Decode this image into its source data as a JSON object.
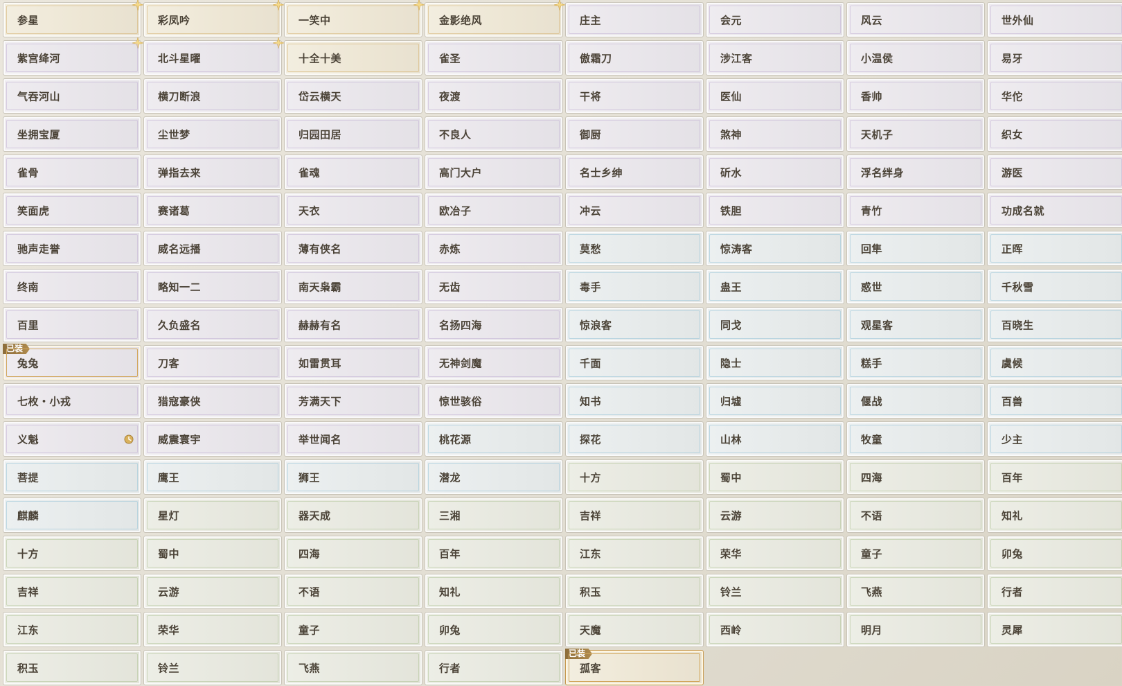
{
  "equipped_tag": "已装",
  "colors": {
    "gold": "#d5b474",
    "purple": "#c4b6d6",
    "blue": "#9cc7d8",
    "green": "#b4c69c",
    "label": "#4b4337",
    "equipped_tag_bg": "#9a7a44"
  },
  "titles": [
    {
      "label": "参星",
      "tier": "gold",
      "sparkle": true
    },
    {
      "label": "彩凤吟",
      "tier": "gold",
      "sparkle": true
    },
    {
      "label": "一笑中",
      "tier": "gold",
      "sparkle": true
    },
    {
      "label": "金影绝风",
      "tier": "gold",
      "sparkle": true
    },
    {
      "label": "庄主",
      "tier": "purple"
    },
    {
      "label": "会元",
      "tier": "purple"
    },
    {
      "label": "风云",
      "tier": "purple"
    },
    {
      "label": "世外仙",
      "tier": "purple"
    },
    {
      "label": "紫宫绛河",
      "tier": "purple",
      "sparkle": true
    },
    {
      "label": "北斗星曜",
      "tier": "purple",
      "sparkle": true
    },
    {
      "label": "十全十美",
      "tier": "gold"
    },
    {
      "label": "雀圣",
      "tier": "purple"
    },
    {
      "label": "傲霜刀",
      "tier": "purple"
    },
    {
      "label": "涉江客",
      "tier": "purple"
    },
    {
      "label": "小温侯",
      "tier": "purple"
    },
    {
      "label": "易牙",
      "tier": "purple"
    },
    {
      "label": "气吞河山",
      "tier": "purple"
    },
    {
      "label": "横刀断浪",
      "tier": "purple"
    },
    {
      "label": "岱云横天",
      "tier": "purple"
    },
    {
      "label": "夜渡",
      "tier": "purple"
    },
    {
      "label": "干将",
      "tier": "purple"
    },
    {
      "label": "医仙",
      "tier": "purple"
    },
    {
      "label": "香帅",
      "tier": "purple"
    },
    {
      "label": "华佗",
      "tier": "purple"
    },
    {
      "label": "坐拥宝厦",
      "tier": "purple"
    },
    {
      "label": "尘世梦",
      "tier": "purple"
    },
    {
      "label": "归园田居",
      "tier": "purple"
    },
    {
      "label": "不良人",
      "tier": "purple"
    },
    {
      "label": "御厨",
      "tier": "purple"
    },
    {
      "label": "煞神",
      "tier": "purple"
    },
    {
      "label": "天机子",
      "tier": "purple"
    },
    {
      "label": "织女",
      "tier": "purple"
    },
    {
      "label": "雀骨",
      "tier": "purple"
    },
    {
      "label": "弹指去来",
      "tier": "purple"
    },
    {
      "label": "雀魂",
      "tier": "purple"
    },
    {
      "label": "高门大户",
      "tier": "purple"
    },
    {
      "label": "名士乡绅",
      "tier": "purple"
    },
    {
      "label": "斫水",
      "tier": "purple"
    },
    {
      "label": "浮名绊身",
      "tier": "purple"
    },
    {
      "label": "游医",
      "tier": "purple"
    },
    {
      "label": "笑面虎",
      "tier": "purple"
    },
    {
      "label": "赛诸葛",
      "tier": "purple"
    },
    {
      "label": "天衣",
      "tier": "purple"
    },
    {
      "label": "欧冶子",
      "tier": "purple"
    },
    {
      "label": "冲云",
      "tier": "purple"
    },
    {
      "label": "铁胆",
      "tier": "purple"
    },
    {
      "label": "青竹",
      "tier": "purple"
    },
    {
      "label": "功成名就",
      "tier": "purple"
    },
    {
      "label": "驰声走誉",
      "tier": "purple"
    },
    {
      "label": "威名远播",
      "tier": "purple"
    },
    {
      "label": "薄有侠名",
      "tier": "purple"
    },
    {
      "label": "赤炼",
      "tier": "purple"
    },
    {
      "label": "莫愁",
      "tier": "blue"
    },
    {
      "label": "惊涛客",
      "tier": "blue"
    },
    {
      "label": "回隼",
      "tier": "blue"
    },
    {
      "label": "正晖",
      "tier": "blue"
    },
    {
      "label": "终南",
      "tier": "purple"
    },
    {
      "label": "略知一二",
      "tier": "purple"
    },
    {
      "label": "南天枭霸",
      "tier": "purple"
    },
    {
      "label": "无齿",
      "tier": "purple"
    },
    {
      "label": "毒手",
      "tier": "blue"
    },
    {
      "label": "蛊王",
      "tier": "blue"
    },
    {
      "label": "惑世",
      "tier": "blue"
    },
    {
      "label": "千秋雪",
      "tier": "blue"
    },
    {
      "label": "百里",
      "tier": "purple"
    },
    {
      "label": "久负盛名",
      "tier": "purple"
    },
    {
      "label": "赫赫有名",
      "tier": "purple"
    },
    {
      "label": "名扬四海",
      "tier": "purple"
    },
    {
      "label": "惊浪客",
      "tier": "blue"
    },
    {
      "label": "同戈",
      "tier": "blue"
    },
    {
      "label": "观星客",
      "tier": "blue"
    },
    {
      "label": "百晓生",
      "tier": "blue"
    },
    {
      "label": "兔兔",
      "tier": "purple",
      "equipped": true
    },
    {
      "label": "刀客",
      "tier": "purple"
    },
    {
      "label": "如雷贯耳",
      "tier": "purple"
    },
    {
      "label": "无神剑魔",
      "tier": "purple"
    },
    {
      "label": "千面",
      "tier": "blue"
    },
    {
      "label": "隐士",
      "tier": "blue"
    },
    {
      "label": "糕手",
      "tier": "blue"
    },
    {
      "label": "虞候",
      "tier": "blue"
    },
    {
      "label": "七枚・小戎",
      "tier": "purple"
    },
    {
      "label": "猎寇豪侠",
      "tier": "purple"
    },
    {
      "label": "芳满天下",
      "tier": "purple"
    },
    {
      "label": "惊世骇俗",
      "tier": "purple"
    },
    {
      "label": "知书",
      "tier": "blue"
    },
    {
      "label": "归墟",
      "tier": "blue"
    },
    {
      "label": "偃战",
      "tier": "blue"
    },
    {
      "label": "百兽",
      "tier": "blue"
    },
    {
      "label": "义魁",
      "tier": "purple",
      "timed": true
    },
    {
      "label": "威震寰宇",
      "tier": "purple"
    },
    {
      "label": "举世闻名",
      "tier": "purple"
    },
    {
      "label": "桃花源",
      "tier": "blue"
    },
    {
      "label": "探花",
      "tier": "blue"
    },
    {
      "label": "山林",
      "tier": "blue"
    },
    {
      "label": "牧童",
      "tier": "blue"
    },
    {
      "label": "少主",
      "tier": "blue"
    },
    {
      "label": "菩提",
      "tier": "blue"
    },
    {
      "label": "鹰王",
      "tier": "blue"
    },
    {
      "label": "狮王",
      "tier": "blue"
    },
    {
      "label": "潜龙",
      "tier": "blue"
    },
    {
      "label": "十方",
      "tier": "green"
    },
    {
      "label": "蜀中",
      "tier": "green"
    },
    {
      "label": "四海",
      "tier": "green"
    },
    {
      "label": "百年",
      "tier": "green"
    },
    {
      "label": "麒麟",
      "tier": "blue"
    },
    {
      "label": "星灯",
      "tier": "green"
    },
    {
      "label": "器天成",
      "tier": "green"
    },
    {
      "label": "三湘",
      "tier": "green"
    },
    {
      "label": "吉祥",
      "tier": "green"
    },
    {
      "label": "云游",
      "tier": "green"
    },
    {
      "label": "不语",
      "tier": "green"
    },
    {
      "label": "知礼",
      "tier": "green"
    },
    {
      "label": "十方",
      "tier": "green"
    },
    {
      "label": "蜀中",
      "tier": "green"
    },
    {
      "label": "四海",
      "tier": "green"
    },
    {
      "label": "百年",
      "tier": "green"
    },
    {
      "label": "江东",
      "tier": "green"
    },
    {
      "label": "荣华",
      "tier": "green"
    },
    {
      "label": "童子",
      "tier": "green"
    },
    {
      "label": "卯兔",
      "tier": "green"
    },
    {
      "label": "吉祥",
      "tier": "green"
    },
    {
      "label": "云游",
      "tier": "green"
    },
    {
      "label": "不语",
      "tier": "green"
    },
    {
      "label": "知礼",
      "tier": "green"
    },
    {
      "label": "积玉",
      "tier": "green"
    },
    {
      "label": "铃兰",
      "tier": "green"
    },
    {
      "label": "飞燕",
      "tier": "green"
    },
    {
      "label": "行者",
      "tier": "green"
    },
    {
      "label": "江东",
      "tier": "green"
    },
    {
      "label": "荣华",
      "tier": "green"
    },
    {
      "label": "童子",
      "tier": "green"
    },
    {
      "label": "卯兔",
      "tier": "green"
    },
    {
      "label": "天魔",
      "tier": "green"
    },
    {
      "label": "西岭",
      "tier": "green"
    },
    {
      "label": "明月",
      "tier": "green"
    },
    {
      "label": "灵犀",
      "tier": "green"
    },
    {
      "label": "积玉",
      "tier": "green"
    },
    {
      "label": "铃兰",
      "tier": "green"
    },
    {
      "label": "飞燕",
      "tier": "green"
    },
    {
      "label": "行者",
      "tier": "green"
    },
    {
      "label": "孤客",
      "tier": "gold",
      "equipped": true
    }
  ]
}
